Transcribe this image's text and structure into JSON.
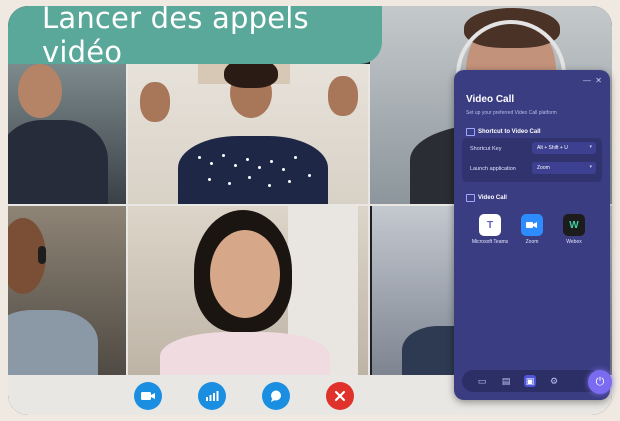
{
  "banner": {
    "title": "Lancer des appels vidéo"
  },
  "panel": {
    "title": "Video Call",
    "subtitle": "Set up your preferred Video Call platform",
    "shortcut_section": "Shortcut to Video Call",
    "shortcut_key_label": "Shortcut Key",
    "shortcut_key_value": "Alt + Shift + U",
    "launch_label": "Launch application",
    "launch_value": "Zoom",
    "video_section": "Video Call",
    "apps": [
      {
        "label": "Microsoft Teams",
        "icon": "teams-icon",
        "color": "#5b5fc7"
      },
      {
        "label": "Zoom",
        "icon": "zoom-icon",
        "color": "#2d8cff"
      },
      {
        "label": "Webex",
        "icon": "webex-icon",
        "color": "#1c1c1c"
      }
    ]
  },
  "callbar": {
    "buttons": [
      {
        "icon": "camera-icon",
        "color": "#1a8ee0"
      },
      {
        "icon": "bar-chart-icon",
        "color": "#1a8ee0"
      },
      {
        "icon": "chat-bubble-icon",
        "color": "#1a8ee0"
      },
      {
        "icon": "close-icon",
        "color": "#e0322b"
      }
    ]
  }
}
